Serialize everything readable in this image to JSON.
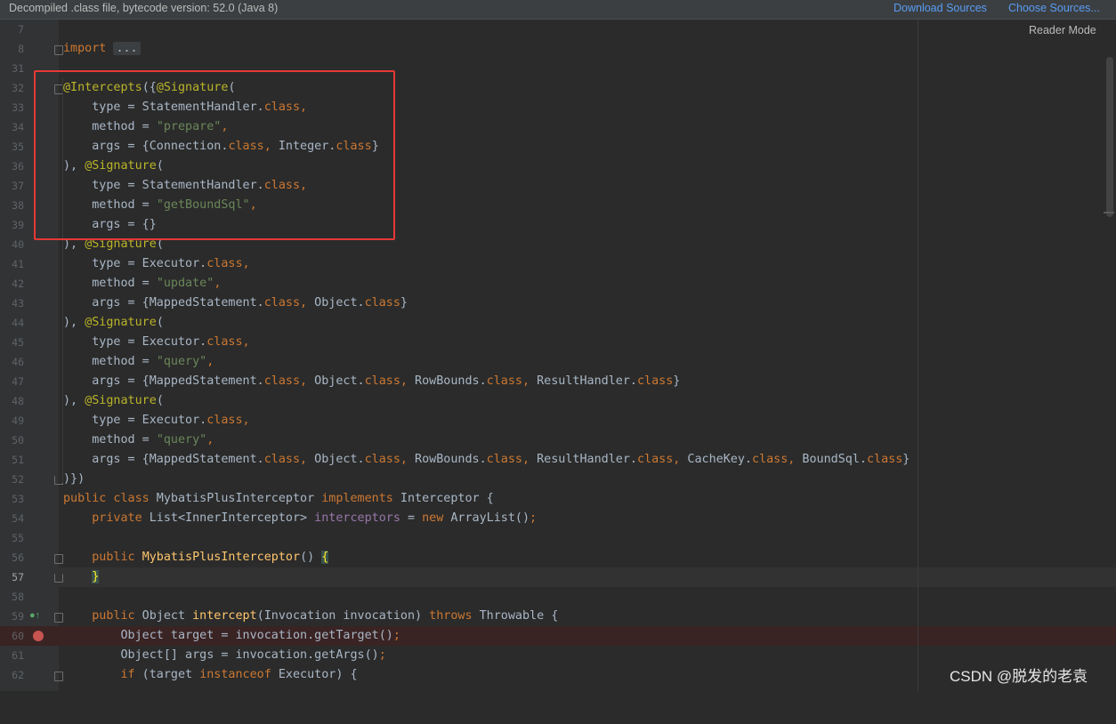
{
  "banner": {
    "message": "Decompiled .class file, bytecode version: 52.0 (Java 8)",
    "download_sources": "Download Sources",
    "choose_sources": "Choose Sources..."
  },
  "editor": {
    "reader_mode": "Reader Mode",
    "current_line": "57",
    "breakpoint_line": "60",
    "lines": [
      {
        "n": "7"
      },
      {
        "n": "8"
      },
      {
        "n": "31"
      },
      {
        "n": "32"
      },
      {
        "n": "33"
      },
      {
        "n": "34"
      },
      {
        "n": "35"
      },
      {
        "n": "36"
      },
      {
        "n": "37"
      },
      {
        "n": "38"
      },
      {
        "n": "39"
      },
      {
        "n": "40"
      },
      {
        "n": "41"
      },
      {
        "n": "42"
      },
      {
        "n": "43"
      },
      {
        "n": "44"
      },
      {
        "n": "45"
      },
      {
        "n": "46"
      },
      {
        "n": "47"
      },
      {
        "n": "48"
      },
      {
        "n": "49"
      },
      {
        "n": "50"
      },
      {
        "n": "51"
      },
      {
        "n": "52"
      },
      {
        "n": "53"
      },
      {
        "n": "54"
      },
      {
        "n": "55"
      },
      {
        "n": "56"
      },
      {
        "n": "57"
      },
      {
        "n": "58"
      },
      {
        "n": "59"
      },
      {
        "n": "60"
      },
      {
        "n": "61"
      },
      {
        "n": "62"
      }
    ],
    "code": {
      "l8_import": "import",
      "l8_folded": "...",
      "l32_a": "@Intercepts",
      "l32_b": "({",
      "l32_c": "@Signature",
      "l32_d": "(",
      "l33_a": "    type = StatementHandler.",
      "l33_b": "class,",
      "l34_a": "    method = ",
      "l34_b": "\"prepare\"",
      "l34_c": ",",
      "l35_a": "    args = {Connection.",
      "l35_b": "class,",
      "l35_c": " Integer.",
      "l35_d": "class",
      "l35_e": "}",
      "l36_a": "), ",
      "l36_b": "@Signature",
      "l36_c": "(",
      "l37_a": "    type = StatementHandler.",
      "l37_b": "class,",
      "l38_a": "    method = ",
      "l38_b": "\"getBoundSql\"",
      "l38_c": ",",
      "l39_a": "    args = {}",
      "l40_a": "), ",
      "l40_b": "@Signature",
      "l40_c": "(",
      "l41_a": "    type = Executor.",
      "l41_b": "class,",
      "l42_a": "    method = ",
      "l42_b": "\"update\"",
      "l42_c": ",",
      "l43_a": "    args = {MappedStatement.",
      "l43_b": "class,",
      "l43_c": " Object.",
      "l43_d": "class",
      "l43_e": "}",
      "l44_a": "), ",
      "l44_b": "@Signature",
      "l44_c": "(",
      "l45_a": "    type = Executor.",
      "l45_b": "class,",
      "l46_a": "    method = ",
      "l46_b": "\"query\"",
      "l46_c": ",",
      "l47_a": "    args = {MappedStatement.",
      "l47_b": "class,",
      "l47_c": " Object.",
      "l47_d": "class,",
      "l47_e": " RowBounds.",
      "l47_f": "class,",
      "l47_g": " ResultHandler.",
      "l47_h": "class",
      "l47_i": "}",
      "l48_a": "), ",
      "l48_b": "@Signature",
      "l48_c": "(",
      "l49_a": "    type = Executor.",
      "l49_b": "class,",
      "l50_a": "    method = ",
      "l50_b": "\"query\"",
      "l50_c": ",",
      "l51_a": "    args = {MappedStatement.",
      "l51_b": "class,",
      "l51_c": " Object.",
      "l51_d": "class,",
      "l51_e": " RowBounds.",
      "l51_f": "class,",
      "l51_g": " ResultHandler.",
      "l51_h": "class,",
      "l51_i": " CacheKey.",
      "l51_j": "class,",
      "l51_k": " BoundSql.",
      "l51_l": "class",
      "l51_m": "}",
      "l52_a": ")})",
      "l53_a": "public class",
      "l53_b": " MybatisPlusInterceptor ",
      "l53_c": "implements",
      "l53_d": " Interceptor {",
      "l54_a": "    private",
      "l54_b": " List<InnerInterceptor> ",
      "l54_c": "interceptors",
      "l54_d": " = ",
      "l54_e": "new",
      "l54_f": " ArrayList()",
      "l54_g": ";",
      "l56_a": "    public",
      "l56_b": " ",
      "l56_c": "MybatisPlusInterceptor",
      "l56_d": "() ",
      "l56_e": "{",
      "l57_a": "    ",
      "l57_b": "}",
      "l59_a": "    public",
      "l59_b": " Object ",
      "l59_c": "intercept",
      "l59_d": "(Invocation invocation) ",
      "l59_e": "throws",
      "l59_f": " Throwable {",
      "l60_a": "        Object target = invocation.getTarget()",
      "l60_b": ";",
      "l61_a": "        Object[] args = invocation.getArgs()",
      "l61_b": ";",
      "l62_a": "        if",
      "l62_b": " (target ",
      "l62_c": "instanceof",
      "l62_d": " Executor) {"
    }
  },
  "watermark": "CSDN @脱发的老袁"
}
